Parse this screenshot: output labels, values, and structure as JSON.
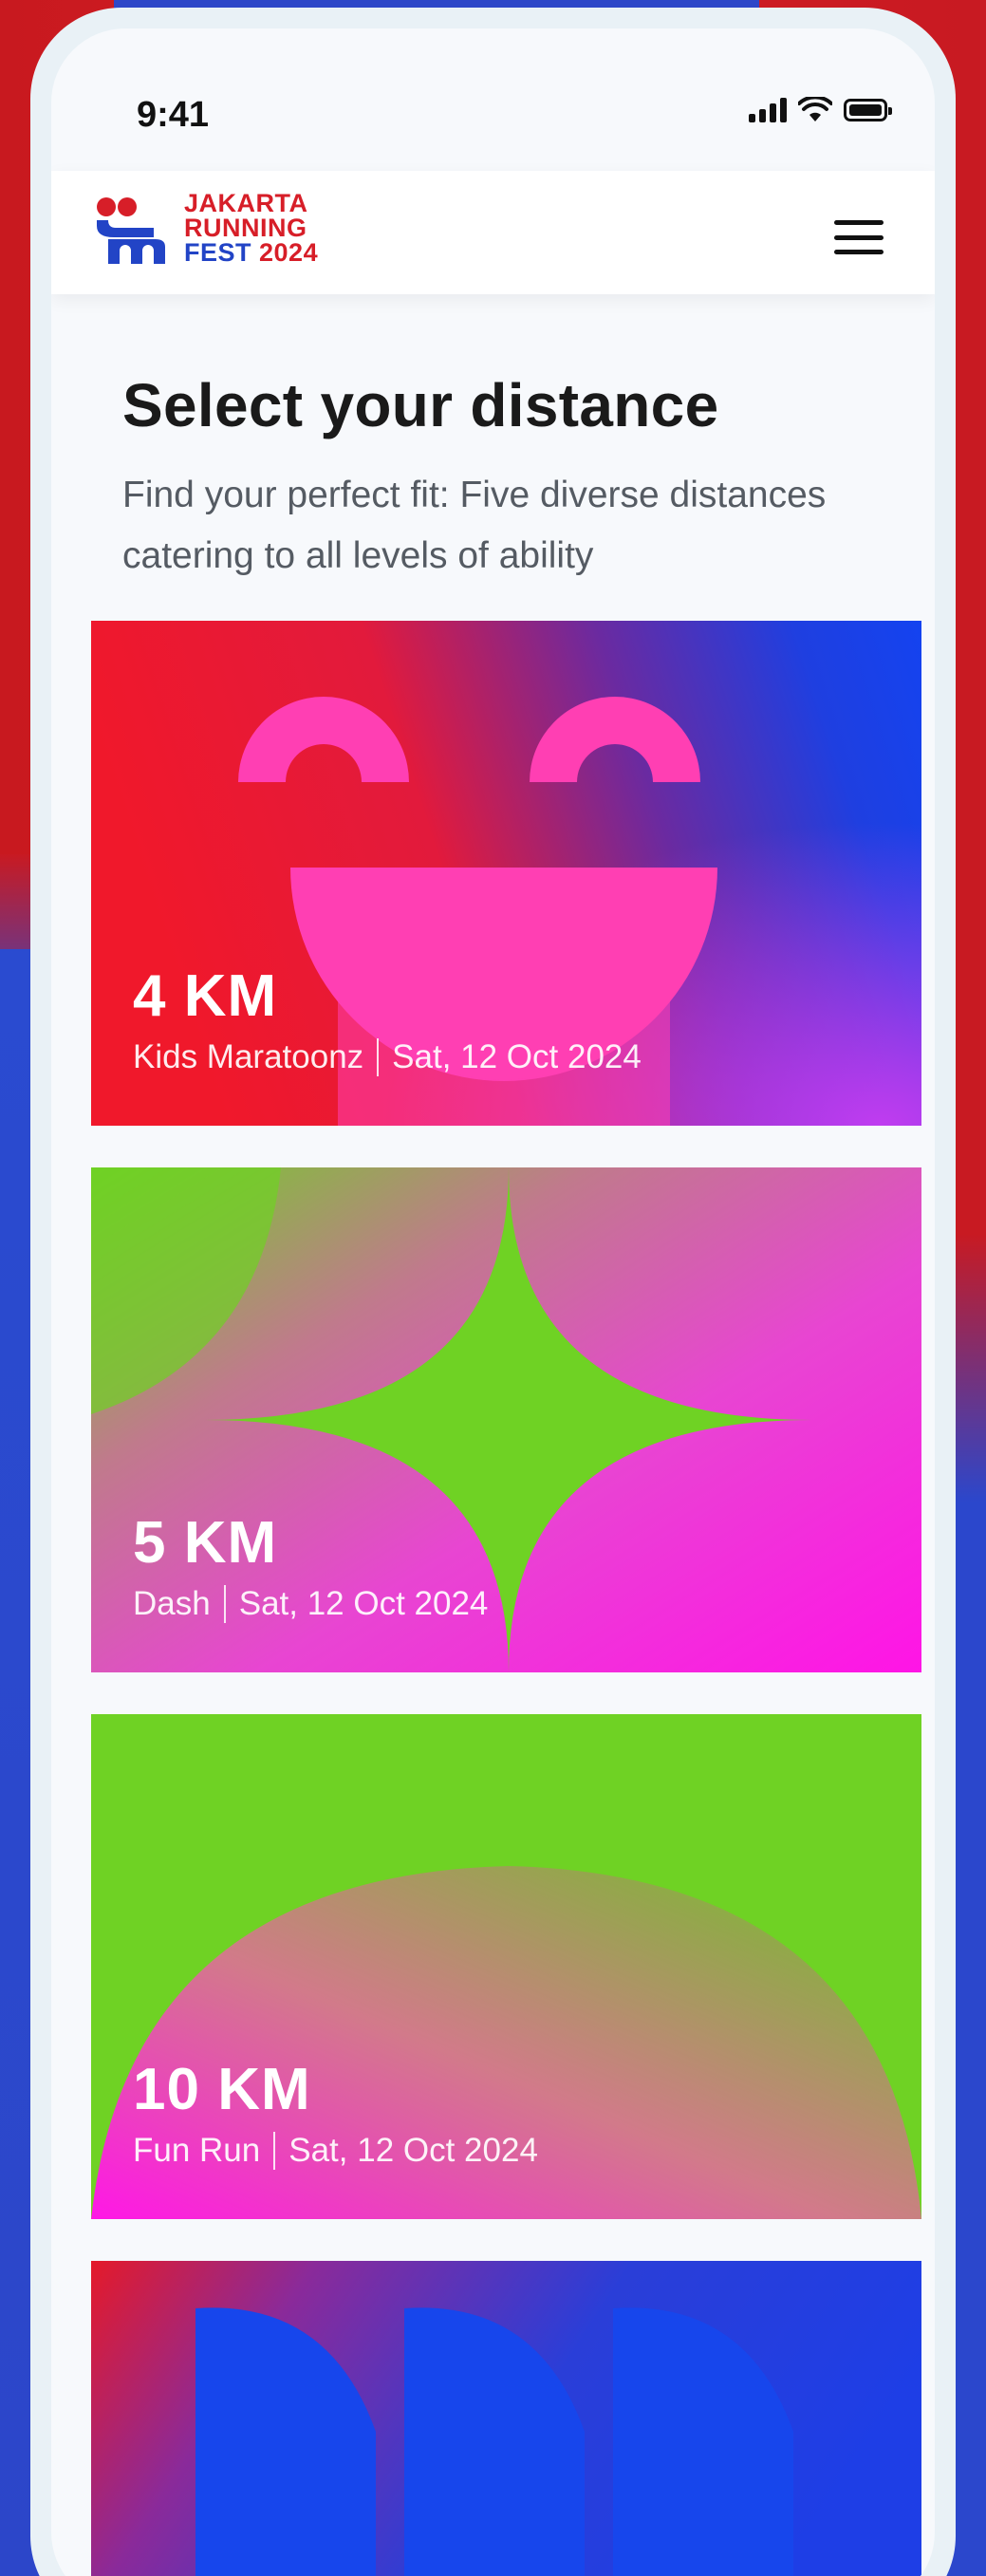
{
  "status_bar": {
    "time": "9:41"
  },
  "header": {
    "logo_lines": [
      "JAKARTA",
      "RUNNING",
      "FEST ",
      "2024"
    ]
  },
  "page": {
    "title": "Select your distance",
    "subtitle": "Find your perfect fit: Five diverse distances catering to all levels of ability"
  },
  "cards": [
    {
      "distance": "4 KM",
      "category": "Kids Maratoonz",
      "date": "Sat, 12 Oct 2024"
    },
    {
      "distance": "5 KM",
      "category": "Dash",
      "date": "Sat, 12 Oct 2024"
    },
    {
      "distance": "10 KM",
      "category": "Fun Run",
      "date": "Sat, 12 Oct 2024"
    }
  ],
  "colors": {
    "brand_red": "#d71e28",
    "brand_blue": "#2244c6",
    "pink": "#ff3fb3",
    "green": "#6fd224",
    "magenta": "#ff17e6"
  },
  "icons": [
    "signal-icon",
    "wifi-icon",
    "battery-icon",
    "menu-icon",
    "logo-mark-icon"
  ]
}
